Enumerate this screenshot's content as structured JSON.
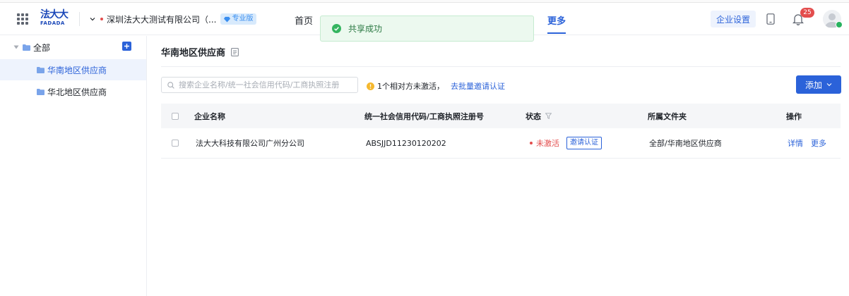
{
  "header": {
    "logo_cn": "法大大",
    "logo_en": "FADADA",
    "company_name": "深圳法大大测试有限公司（...",
    "edition_badge": "专业版",
    "nav": [
      {
        "label": "首页",
        "active": false
      },
      {
        "label": "更多",
        "active": true
      }
    ],
    "enterprise_settings_label": "企业设置",
    "notification_count": "25"
  },
  "toast": {
    "message": "共享成功"
  },
  "sidebar": {
    "root_label": "全部",
    "items": [
      {
        "label": "华南地区供应商",
        "active": true
      },
      {
        "label": "华北地区供应商",
        "active": false
      }
    ]
  },
  "main": {
    "title": "华南地区供应商",
    "search_placeholder": "搜索企业名称/统一社会信用代码/工商执照注册",
    "notice_text": "1个相对方未激活，",
    "notice_link": "去批量邀请认证",
    "add_label": "添加"
  },
  "table": {
    "columns": [
      "企业名称",
      "统一社会信用代码/工商执照注册号",
      "状态",
      "所属文件夹",
      "操作"
    ],
    "rows": [
      {
        "name": "法大大科技有限公司广州分公司",
        "code": "ABSJJD11230120202",
        "status": "未激活",
        "invite_label": "邀请认证",
        "folder": "全部/华南地区供应商",
        "actions": [
          "详情",
          "更多"
        ]
      }
    ]
  },
  "colors": {
    "primary": "#2b62d9",
    "danger": "#e34d4d",
    "success_bg": "#ecf9ef",
    "warning": "#f5b82e"
  }
}
